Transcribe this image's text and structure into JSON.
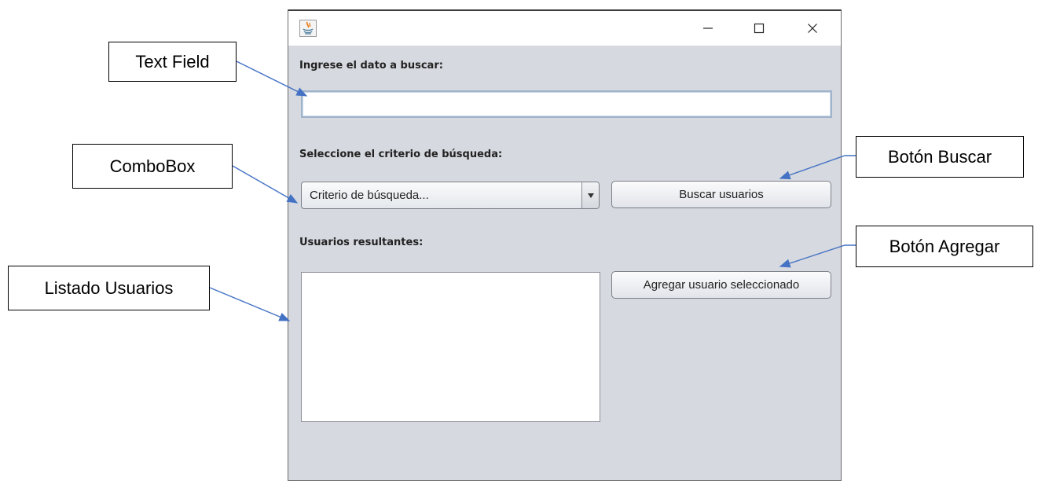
{
  "annotations": {
    "text_field": "Text Field",
    "combobox": "ComboBox",
    "user_list": "Listado Usuarios",
    "search_button": "Botón Buscar",
    "add_button": "Botón Agregar"
  },
  "window": {
    "title": "",
    "controls": {
      "minimize": "–",
      "maximize": "☐",
      "close": "✕"
    }
  },
  "form": {
    "search_label": "Ingrese el dato a buscar:",
    "search_value": "",
    "criteria_label": "Seleccione el criterio de búsqueda:",
    "criteria_selected": "Criterio de búsqueda...",
    "search_button": "Buscar usuarios",
    "results_label": "Usuarios resultantes:",
    "results": [],
    "add_button": "Agregar usuario seleccionado"
  },
  "colors": {
    "window_bg": "#d6d9df",
    "arrow": "#4472c4",
    "text_field_border": "#9fb4cb"
  }
}
